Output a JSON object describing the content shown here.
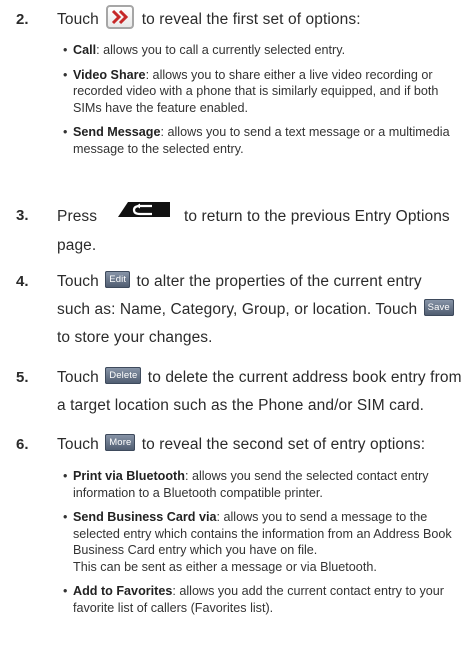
{
  "steps": [
    {
      "num": "2.",
      "pre": "Touch",
      "post": "to reveal the first set of options:"
    },
    {
      "num": "3.",
      "pre": "Press",
      "post": "to return to the previous Entry Options",
      "post2": "page."
    },
    {
      "num": "4.",
      "pre": "Touch",
      "btn": "Edit",
      "post": "to alter the properties of the current entry",
      "line2": "such as: Name, Category, Group, or location. Touch",
      "btn2": "Save",
      "line3": "to store your changes."
    },
    {
      "num": "5.",
      "pre": "Touch",
      "btn": "Delete",
      "post": "to delete the current address book entry from",
      "line2": "a target location such as the Phone and/or SIM card."
    },
    {
      "num": "6.",
      "pre": "Touch",
      "btn": "More",
      "post": "to reveal the second set of entry options:"
    }
  ],
  "first_options": [
    {
      "term": "Call",
      "desc": ": allows you to call a currently selected entry."
    },
    {
      "term": "Video Share",
      "desc": ": allows you to share either a live video recording or recorded video with a phone that is similarly equipped, and if both SIMs have the feature enabled."
    },
    {
      "term": "Send Message",
      "desc": ": allows you to send a text message or a multimedia message to the selected entry."
    }
  ],
  "second_options": [
    {
      "term": "Print via Bluetooth",
      "desc": ": allows you send the selected contact entry information to a Bluetooth compatible printer."
    },
    {
      "term": "Send Business Card via",
      "desc": ": allows you to send a message to the selected entry which contains the information from an Address Book Business Card entry which you have on file.",
      "extra": "This can be sent as either a message or via Bluetooth."
    },
    {
      "term": "Add to Favorites",
      "desc": ": allows you add the current contact entry to your favorite list of callers (Favorites list)."
    }
  ],
  "icons": {
    "forward": "double-chevron-right-icon",
    "back": "back-key-icon"
  },
  "colors": {
    "chevron": "#c62828",
    "button": "#5a6679"
  }
}
